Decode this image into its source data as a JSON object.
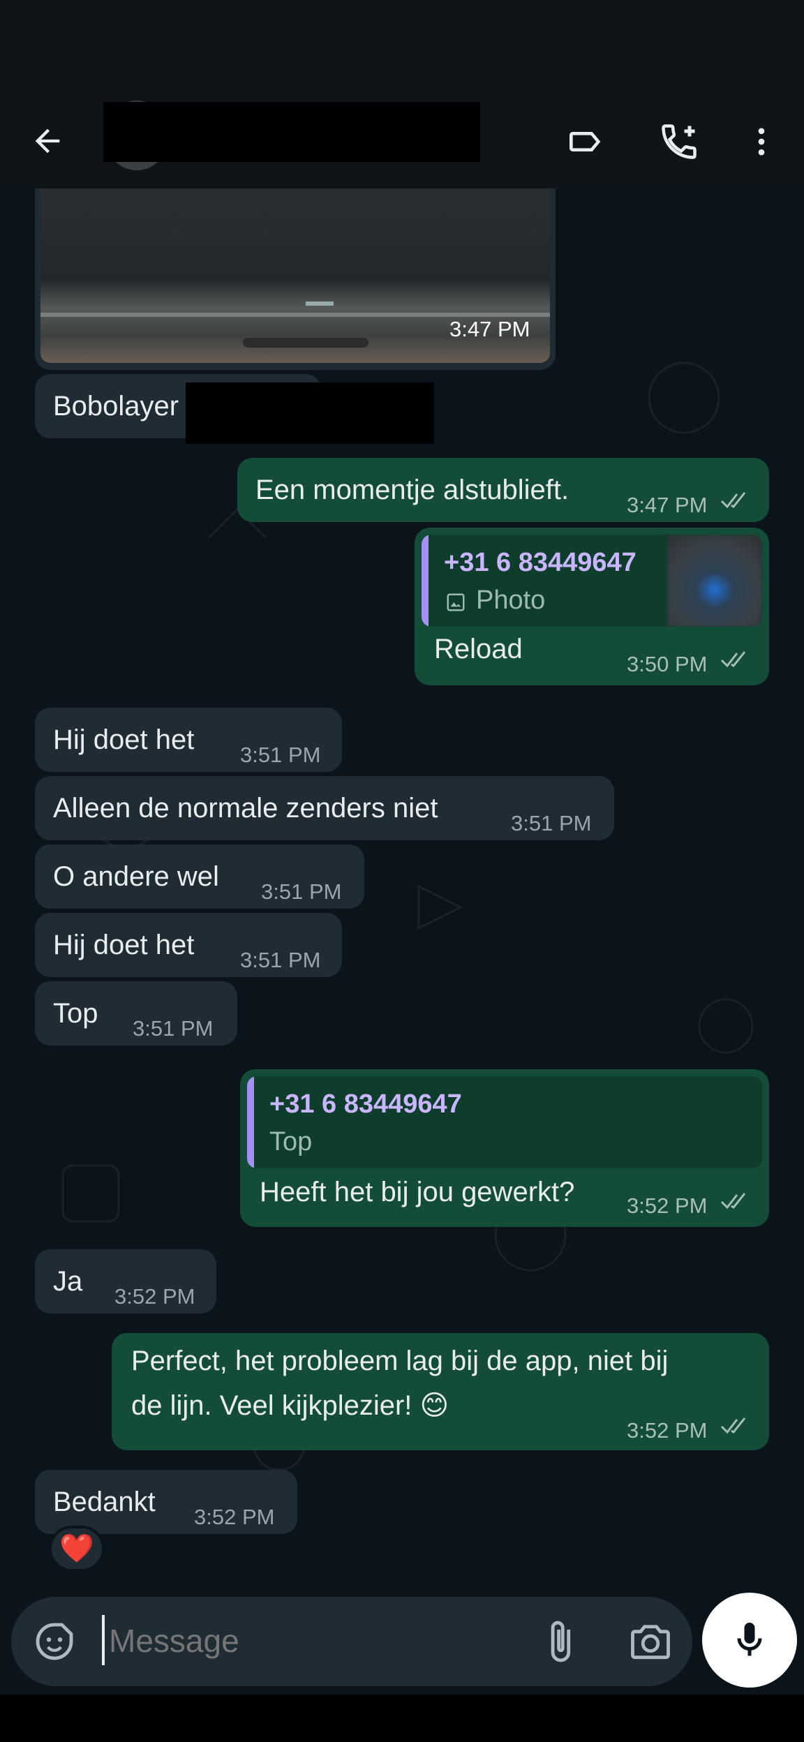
{
  "header": {
    "contact_name": ""
  },
  "messages": {
    "photo_time": "3:47 PM",
    "m1": {
      "text": "Bobolayer",
      "time": ""
    },
    "m2": {
      "text": "Een momentje alstublieft.",
      "time": "3:47 PM"
    },
    "m3": {
      "quote_name": "+31 6 83449647",
      "quote_type": "Photo",
      "text": "Reload",
      "time": "3:50 PM"
    },
    "m4": {
      "text": "Hij doet het",
      "time": "3:51 PM"
    },
    "m5": {
      "text": "Alleen de normale zenders niet",
      "time": "3:51 PM"
    },
    "m6": {
      "text": "O andere wel",
      "time": "3:51 PM"
    },
    "m7": {
      "text": "Hij doet het",
      "time": "3:51 PM"
    },
    "m8": {
      "text": "Top",
      "time": "3:51 PM"
    },
    "m9": {
      "quote_name": "+31 6 83449647",
      "quote_text": "Top",
      "text": "Heeft het bij jou gewerkt?",
      "time": "3:52 PM"
    },
    "m10": {
      "text": "Ja",
      "time": "3:52 PM"
    },
    "m11": {
      "line1": "Perfect, het probleem lag bij de app, niet bij",
      "line2": "de lijn. Veel kijkplezier! 😊",
      "time": "3:52 PM"
    },
    "m12": {
      "text": "Bedankt",
      "time": "3:52 PM",
      "reaction": "❤️"
    }
  },
  "composer": {
    "placeholder": "Message"
  },
  "colors": {
    "incoming": "#1f2c33",
    "outgoing": "#144d37",
    "accent_quote": "#a58ff5",
    "background": "#0b141a"
  },
  "icons": [
    "back-arrow-icon",
    "label-icon",
    "add-call-icon",
    "more-icon",
    "sticker-icon",
    "attach-icon",
    "camera-icon",
    "mic-icon",
    "double-check-icon",
    "image-icon"
  ]
}
